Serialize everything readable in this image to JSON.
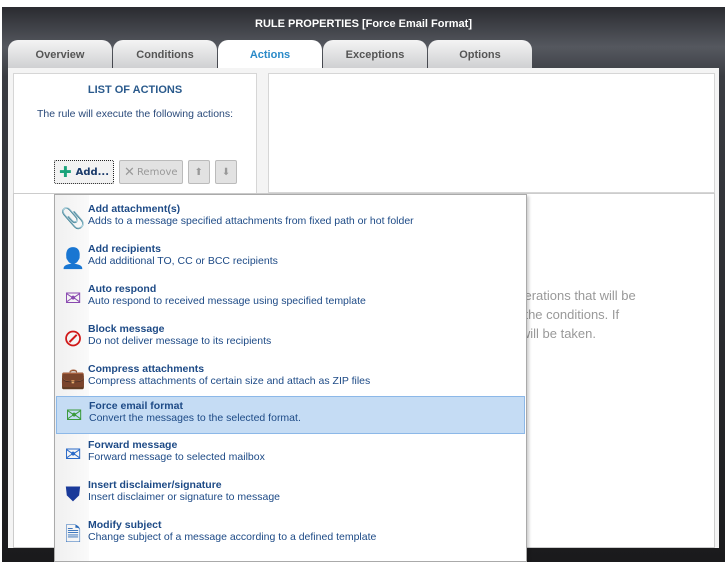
{
  "window": {
    "title": "RULE PROPERTIES [Force Email Format]"
  },
  "tabs": [
    {
      "label": "Overview"
    },
    {
      "label": "Conditions"
    },
    {
      "label": "Actions",
      "active": true
    },
    {
      "label": "Exceptions"
    },
    {
      "label": "Options"
    }
  ],
  "left_panel": {
    "heading": "LIST OF ACTIONS",
    "description": "The rule will execute the following actions:",
    "add_label": "Add...",
    "remove_label": "Remove"
  },
  "hint_lines": [
    "operations that will be",
    "et the conditions. If",
    "n will be taken."
  ],
  "menu": {
    "selected_index": 5,
    "items": [
      {
        "title": "Add attachment(s)",
        "desc": "Adds to a message specified attachments from fixed path or hot folder",
        "icon": "paperclip-icon"
      },
      {
        "title": "Add recipients",
        "desc": "Add additional TO, CC or BCC recipients",
        "icon": "add-user-icon"
      },
      {
        "title": "Auto respond",
        "desc": "Auto respond to received message using specified template",
        "icon": "reply-envelope-icon"
      },
      {
        "title": "Block message",
        "desc": "Do not deliver message to its recipients",
        "icon": "block-icon"
      },
      {
        "title": "Compress attachments",
        "desc": "Compress attachments of certain size and attach as ZIP files",
        "icon": "zip-briefcase-icon"
      },
      {
        "title": "Force email format",
        "desc": "Convert the messages to the selected format.",
        "icon": "convert-envelope-icon"
      },
      {
        "title": "Forward message",
        "desc": "Forward message to selected mailbox",
        "icon": "forward-envelope-icon"
      },
      {
        "title": "Insert disclaimer/signature",
        "desc": "Insert disclaimer or signature to message",
        "icon": "stamp-icon"
      },
      {
        "title": "Modify subject",
        "desc": "Change subject of a message according to a defined template",
        "icon": "document-icon"
      }
    ]
  }
}
